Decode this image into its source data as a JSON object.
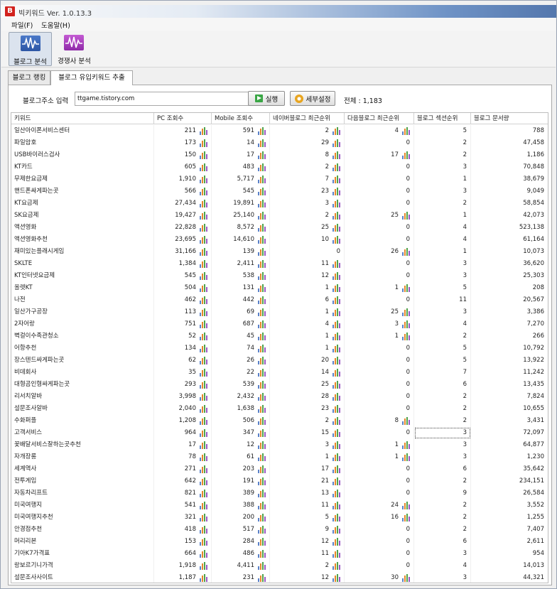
{
  "window": {
    "title": "빅키워드 Ver. 1.0.13.3",
    "icon_letter": "B"
  },
  "menu": [
    "파일(F)",
    "도움말(H)"
  ],
  "toolbar": [
    {
      "label": "블로그 분석",
      "icon": "waveform-blue-icon",
      "active": true
    },
    {
      "label": "경쟁사 분석",
      "icon": "waveform-purple-icon",
      "active": false
    }
  ],
  "tabs": [
    {
      "label": "블로그 랭킹",
      "selected": false
    },
    {
      "label": "블로그 유입키워드 추출",
      "selected": true
    }
  ],
  "form": {
    "url_label": "블로그주소 입력",
    "url_value": "ttgame.tistory.com",
    "run_label": "실행",
    "settings_label": "세부설정",
    "total_text": "전체 : 1,183"
  },
  "columns": [
    "키워드",
    "PC 조회수",
    "Mobile 조회수",
    "네이버블로그 최근순위",
    "다음블로그 최근순위",
    "블로그 섹션순위",
    "블로그 문서량"
  ],
  "colors": {
    "bar_blue": "#5b82c9",
    "bar_orange": "#e6872a",
    "bar_green": "#4fa34c",
    "bar_purple": "#9b59c4"
  },
  "rows": [
    [
      "일산아이폰서비스센터",
      "211",
      "591",
      "2",
      "4",
      "5",
      "788"
    ],
    [
      "파일암호",
      "173",
      "14",
      "29",
      "0",
      "2",
      "47,458"
    ],
    [
      "USB바이러스검사",
      "150",
      "17",
      "8",
      "17",
      "2",
      "1,186"
    ],
    [
      "KT카드",
      "605",
      "483",
      "2",
      "0",
      "3",
      "70,848"
    ],
    [
      "무제한요금제",
      "1,910",
      "5,717",
      "7",
      "0",
      "1",
      "38,679"
    ],
    [
      "핸드폰싸게파는곳",
      "566",
      "545",
      "23",
      "0",
      "3",
      "9,049"
    ],
    [
      "KT요금제",
      "27,434",
      "19,891",
      "3",
      "0",
      "2",
      "58,854"
    ],
    [
      "SK요금제",
      "19,427",
      "25,140",
      "2",
      "25",
      "1",
      "42,073"
    ],
    [
      "액션영화",
      "22,828",
      "8,572",
      "25",
      "0",
      "4",
      "523,138"
    ],
    [
      "액션영화추천",
      "23,695",
      "14,610",
      "10",
      "0",
      "4",
      "61,164"
    ],
    [
      "재미있는플래시게임",
      "31,166",
      "139",
      "0",
      "26",
      "1",
      "10,073"
    ],
    [
      "SKLTE",
      "1,384",
      "2,411",
      "11",
      "0",
      "3",
      "36,620"
    ],
    [
      "KT인터넷요금제",
      "545",
      "538",
      "12",
      "0",
      "3",
      "25,303"
    ],
    [
      "올렛KT",
      "504",
      "131",
      "1",
      "1",
      "5",
      "208"
    ],
    [
      "나전",
      "462",
      "442",
      "6",
      "0",
      "11",
      "20,567"
    ],
    [
      "일산가구공장",
      "113",
      "69",
      "1",
      "25",
      "3",
      "3,386"
    ],
    [
      "2자어랑",
      "751",
      "687",
      "4",
      "3",
      "4",
      "7,270"
    ],
    [
      "벽걸이수족관청소",
      "52",
      "45",
      "1",
      "1",
      "2",
      "266"
    ],
    [
      "어항추천",
      "134",
      "74",
      "1",
      "0",
      "5",
      "10,792"
    ],
    [
      "장스텐드싸게파는곳",
      "62",
      "26",
      "20",
      "0",
      "5",
      "13,922"
    ],
    [
      "비데회사",
      "35",
      "22",
      "14",
      "0",
      "7",
      "11,242"
    ],
    [
      "대형곰인형싸게파는곳",
      "293",
      "539",
      "25",
      "0",
      "6",
      "13,435"
    ],
    [
      "리서치알바",
      "3,998",
      "2,432",
      "28",
      "0",
      "2",
      "7,824"
    ],
    [
      "설문조사알바",
      "2,040",
      "1,638",
      "23",
      "0",
      "2",
      "10,655"
    ],
    [
      "수화퍼플",
      "1,208",
      "506",
      "2",
      "8",
      "2",
      "3,431"
    ],
    [
      "고객서비스",
      "964",
      "347",
      "15",
      "0",
      "3",
      "72,097"
    ],
    [
      "꽃배달서비스잘하는곳추천",
      "17",
      "12",
      "3",
      "1",
      "3",
      "64,877"
    ],
    [
      "자개장롱",
      "78",
      "61",
      "1",
      "1",
      "3",
      "1,230"
    ],
    [
      "세계역사",
      "271",
      "203",
      "17",
      "0",
      "6",
      "35,642"
    ],
    [
      "전투게임",
      "642",
      "191",
      "21",
      "0",
      "2",
      "234,151"
    ],
    [
      "자동차리프트",
      "821",
      "389",
      "13",
      "0",
      "9",
      "26,584"
    ],
    [
      "미국여행지",
      "541",
      "388",
      "11",
      "24",
      "2",
      "3,552"
    ],
    [
      "미국여행지추천",
      "321",
      "200",
      "5",
      "16",
      "2",
      "1,255"
    ],
    [
      "안경점추천",
      "418",
      "517",
      "9",
      "0",
      "2",
      "7,407"
    ],
    [
      "머리리본",
      "153",
      "284",
      "12",
      "0",
      "6",
      "2,611"
    ],
    [
      "기아K7가격표",
      "664",
      "486",
      "11",
      "0",
      "3",
      "954"
    ],
    [
      "랑보르기니가격",
      "1,918",
      "4,411",
      "2",
      "0",
      "4",
      "14,013"
    ],
    [
      "설문조사사이트",
      "1,187",
      "231",
      "12",
      "30",
      "3",
      "44,321"
    ]
  ]
}
